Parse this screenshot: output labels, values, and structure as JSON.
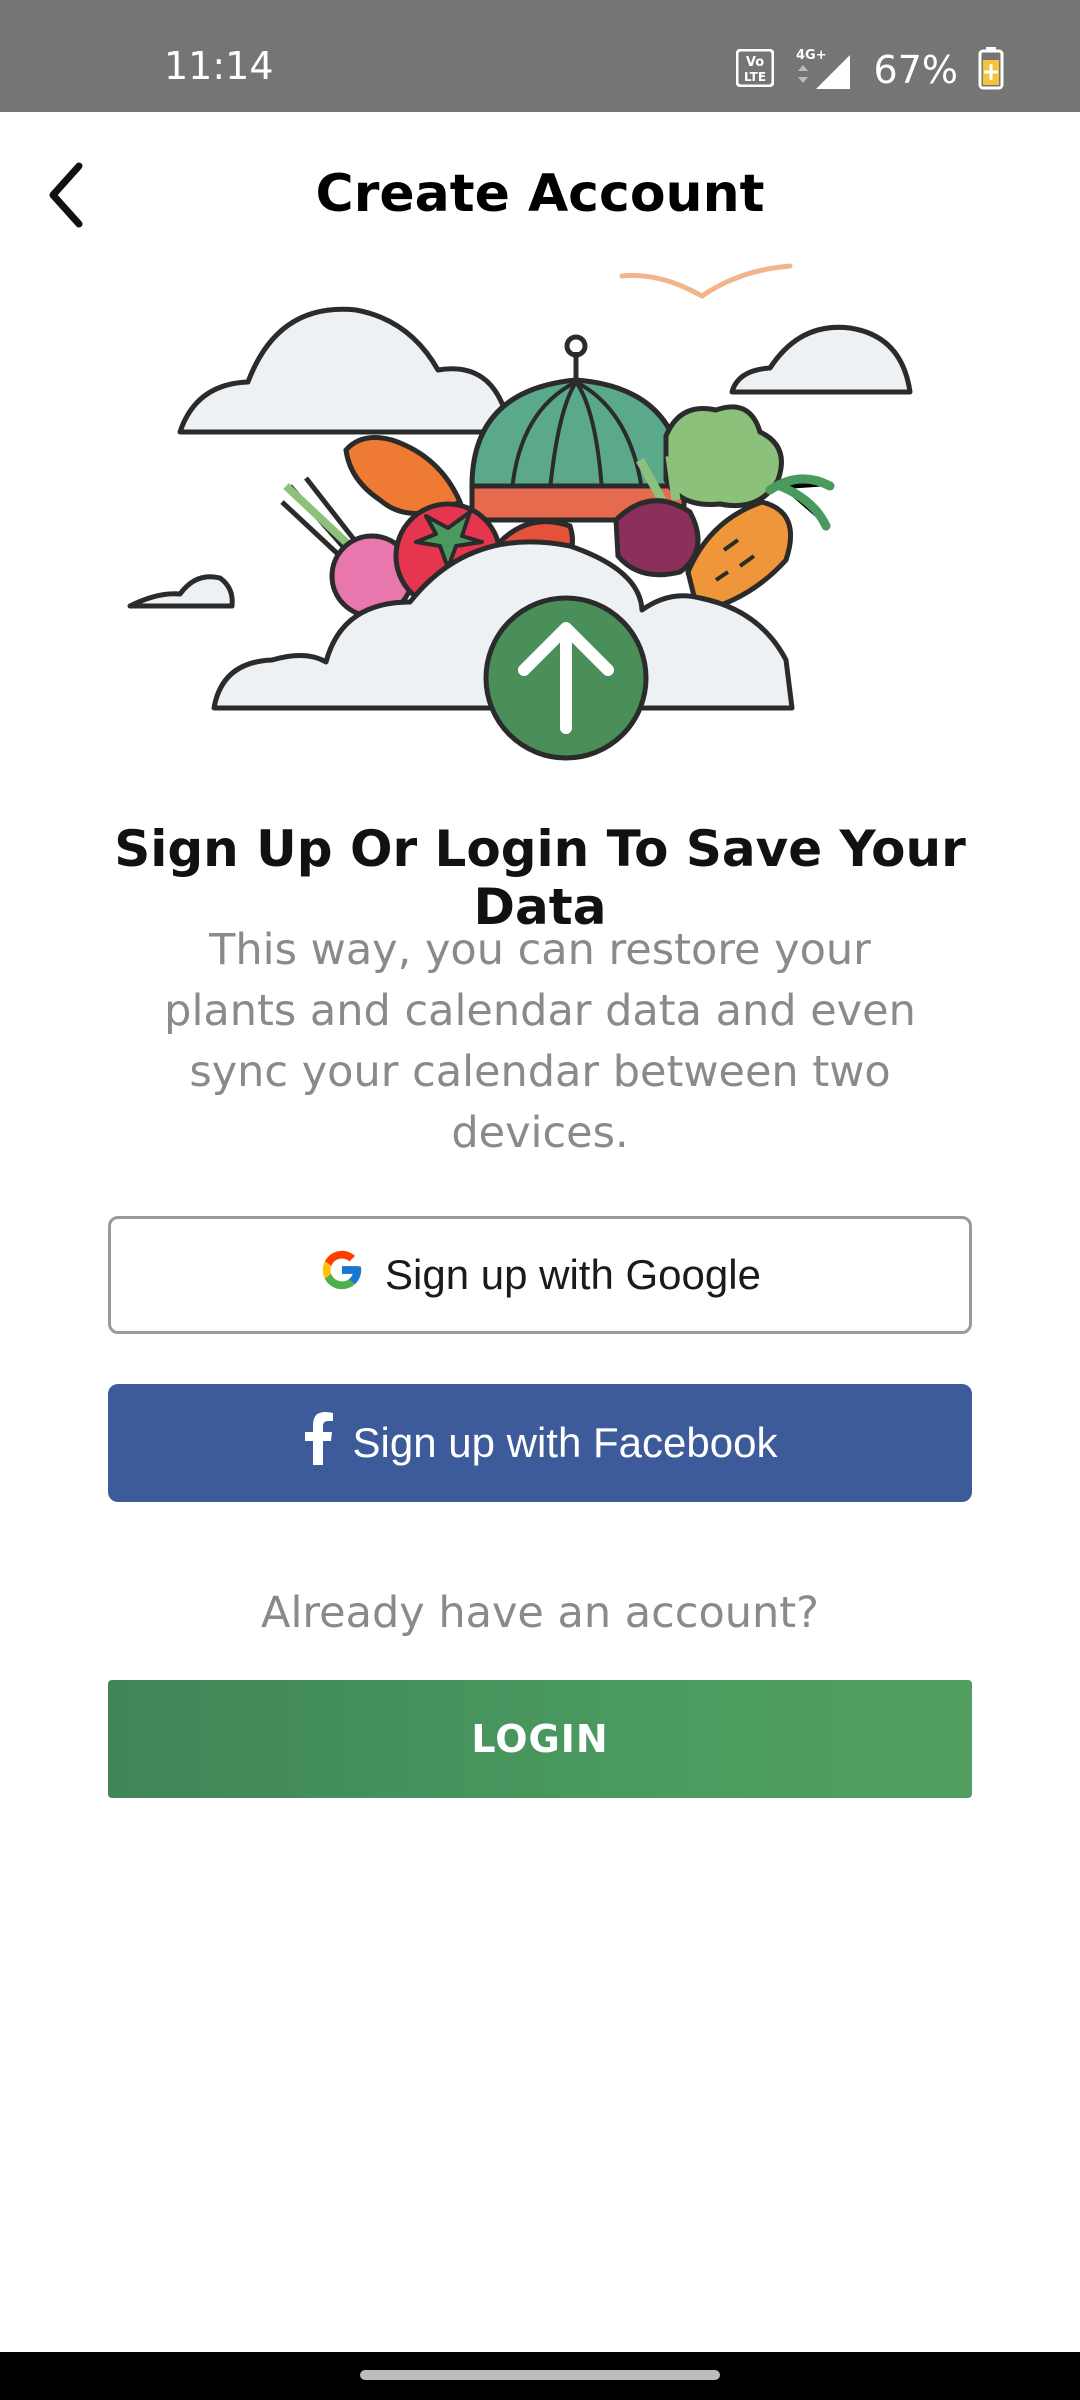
{
  "status_bar": {
    "time": "11:14",
    "battery_percent": "67%",
    "network_label": "4G+",
    "volte_label": "Vo LTE"
  },
  "header": {
    "title": "Create Account",
    "back_icon": "chevron-left-icon"
  },
  "hero": {
    "illustration": "vegetables-cloud-upload-illustration",
    "colors": {
      "cloud": "#eef1f4",
      "outline": "#2b2b2b",
      "upload_circle": "#4a8f5a",
      "carrot": "#ef7a33",
      "tomato": "#e5354f",
      "melon": "#5aa98a",
      "radish": "#e777ad",
      "beet": "#8c2f5a",
      "lettuce": "#8bc17a",
      "bird": "#f2b48a"
    }
  },
  "content": {
    "headline": "Sign Up Or Login To Save Your Data",
    "subtext": "This way, you can restore your plants and calendar data and even sync your calendar between two devices."
  },
  "buttons": {
    "google_label": "Sign up with Google",
    "google_icon": "google-g-icon",
    "facebook_label": "Sign up with Facebook",
    "facebook_icon": "facebook-f-icon",
    "facebook_color": "#3d5a9b",
    "already_text": "Already have an account?",
    "login_label": "LOGIN",
    "login_color": "#4a9a60"
  }
}
